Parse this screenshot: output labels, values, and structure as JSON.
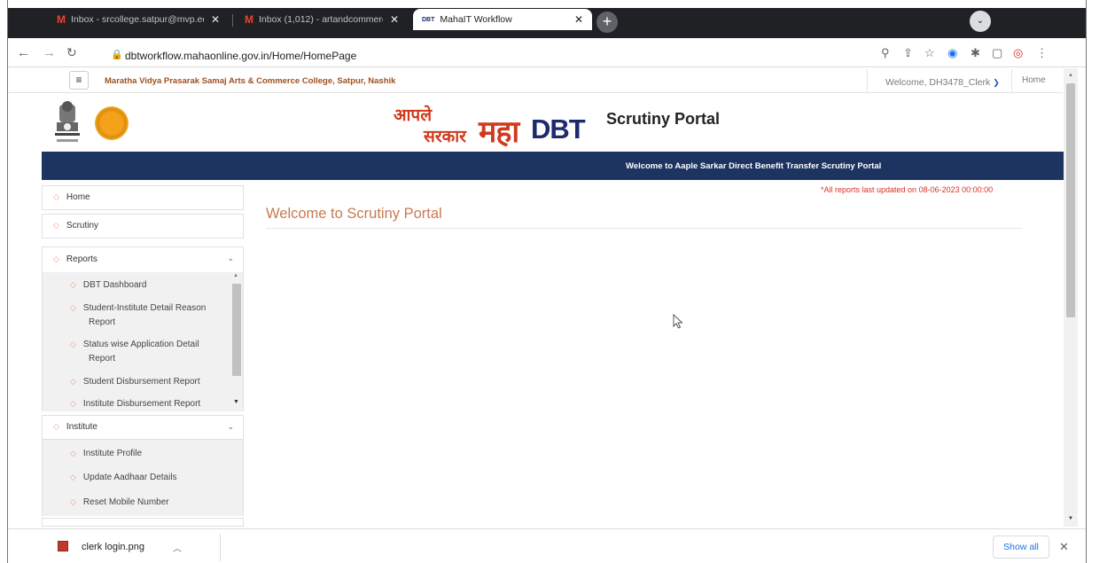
{
  "browser": {
    "tabs": [
      {
        "icon": "M",
        "title": "Inbox - srcollege.satpur@mvp.ed"
      },
      {
        "icon": "M",
        "title": "Inbox (1,012) - artandcommercc"
      },
      {
        "icon": "DBT",
        "title": "MahaIT Workflow"
      }
    ],
    "url": "dbtworkflow.mahaonline.gov.in/Home/HomePage"
  },
  "app": {
    "college_name": "Maratha Vidya Prasarak Samaj Arts & Commerce College, Satpur, Nashik",
    "welcome_user": "Welcome, DH3478_Clerk",
    "home_link": "Home",
    "logo_line1": "आपले",
    "logo_line2": "सरकार",
    "logo_maha": "महा",
    "logo_dbt": "DBT",
    "portal_title": "Scrutiny Portal",
    "banner": "Welcome to Aaple Sarkar Direct Benefit Transfer Scrutiny Portal",
    "report_note": "*All reports last updated on 08-06-2023 00:00:00",
    "page_title": "Welcome to Scrutiny Portal"
  },
  "sidebar": {
    "home": "Home",
    "scrutiny": "Scrutiny",
    "reports": "Reports",
    "report_items": [
      {
        "line1": "DBT Dashboard",
        "line2": ""
      },
      {
        "line1": "Student-Institute Detail Reason",
        "line2": "Report"
      },
      {
        "line1": "Status wise Application Detail",
        "line2": "Report"
      },
      {
        "line1": "Student Disbursement Report",
        "line2": ""
      },
      {
        "line1": "Institute Disbursement Report",
        "line2": ""
      }
    ],
    "institute": "Institute",
    "institute_items": [
      "Institute Profile",
      "Update Aadhaar Details",
      "Reset Mobile Number"
    ]
  },
  "downloads": {
    "file_name": "clerk login.png",
    "show_all": "Show all"
  },
  "colors": {
    "banner_bg": "#1d3461",
    "accent_text": "#c87a52",
    "college_text": "#a0501e",
    "alert_text": "#d93025"
  }
}
